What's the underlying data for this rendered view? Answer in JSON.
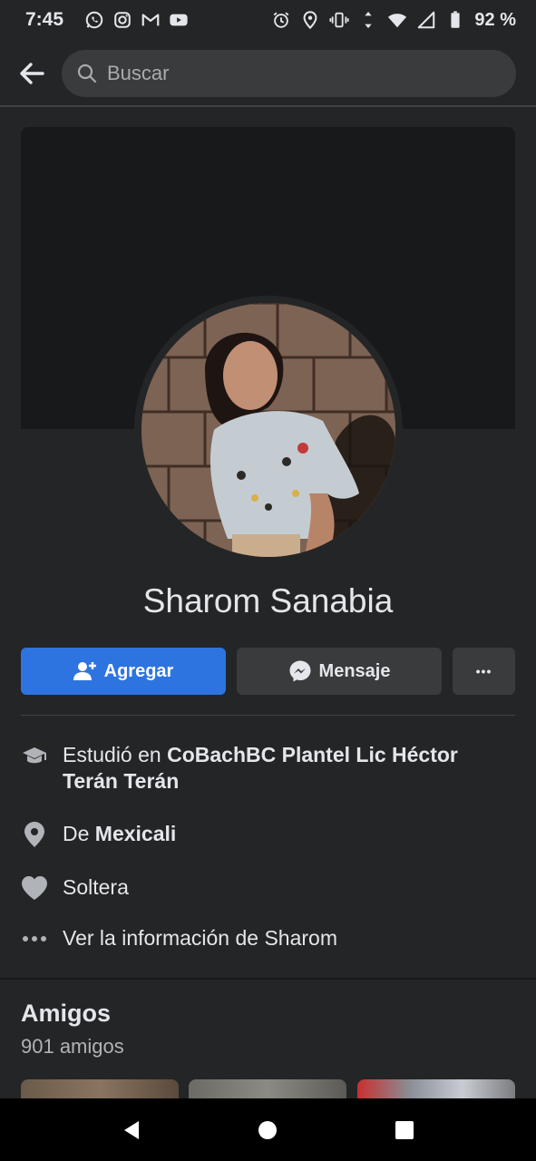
{
  "status_bar": {
    "time": "7:45",
    "battery": "92 %",
    "left_icons": [
      "whatsapp-icon",
      "instagram-icon",
      "gmail-icon",
      "youtube-icon"
    ],
    "right_icons": [
      "alarm-icon",
      "location-icon",
      "vibrate-icon",
      "data-arrows-icon",
      "wifi-icon",
      "signal-icon",
      "battery-icon"
    ]
  },
  "search": {
    "placeholder": "Buscar"
  },
  "profile": {
    "name": "Sharom Sanabia"
  },
  "actions": {
    "add_label": "Agregar",
    "message_label": "Mensaje",
    "more_label": "•••"
  },
  "intro": {
    "studied_prefix": "Estudió en ",
    "studied_school": "CoBachBC Plantel Lic Héctor Terán Terán",
    "from_prefix": "De ",
    "from_city": "Mexicali",
    "relationship": "Soltera",
    "see_info": "Ver la información de Sharom"
  },
  "friends": {
    "title": "Amigos",
    "count": "901 amigos"
  },
  "colors": {
    "background": "#242526",
    "cover": "#18191a",
    "primary_button": "#2d74e0",
    "secondary_button": "#3a3b3c",
    "text_primary": "#e4e6eb",
    "text_secondary": "#b0b3b8"
  }
}
